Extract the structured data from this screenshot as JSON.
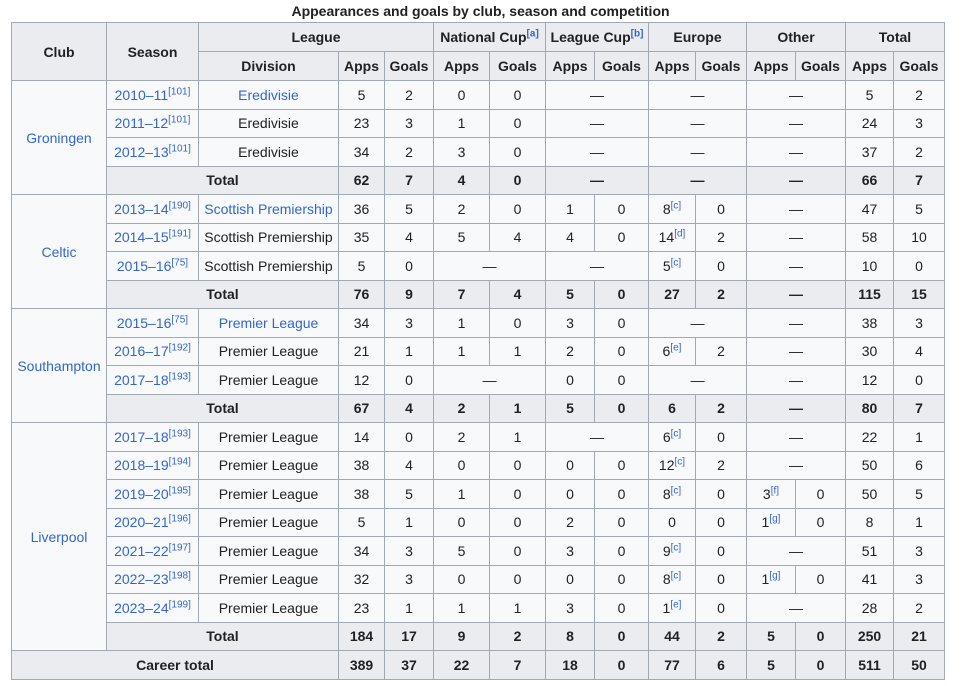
{
  "caption": "Appearances and goals by club, season and competition",
  "headers": {
    "club": "Club",
    "season": "Season",
    "league": "League",
    "national_cup": "National Cup",
    "national_cup_note": "[a]",
    "league_cup": "League Cup",
    "league_cup_note": "[b]",
    "europe": "Europe",
    "other": "Other",
    "total": "Total",
    "division": "Division",
    "apps": "Apps",
    "goals": "Goals"
  },
  "clubs": [
    {
      "name": "Groningen",
      "rows": [
        {
          "season": "2010–11",
          "ref": "[101]",
          "division": "Eredivisie",
          "division_link": true,
          "cells": [
            "5",
            "2",
            "0",
            "0",
            "—",
            "—",
            "—",
            "5",
            "2"
          ],
          "layout": "sng"
        },
        {
          "season": "2011–12",
          "ref": "[101]",
          "division": "Eredivisie",
          "division_link": false,
          "cells": [
            "23",
            "3",
            "1",
            "0",
            "—",
            "—",
            "—",
            "24",
            "3"
          ],
          "layout": "sng"
        },
        {
          "season": "2012–13",
          "ref": "[101]",
          "division": "Eredivisie",
          "division_link": false,
          "cells": [
            "34",
            "2",
            "3",
            "0",
            "—",
            "—",
            "—",
            "37",
            "2"
          ],
          "layout": "sng"
        }
      ],
      "total": {
        "label": "Total",
        "cells": [
          "62",
          "7",
          "4",
          "0",
          "—",
          "—",
          "—",
          "66",
          "7"
        ],
        "layout": "sng"
      }
    },
    {
      "name": "Celtic",
      "rows": [
        {
          "season": "2013–14",
          "ref": "[190]",
          "division": "Scottish Premiership",
          "division_link": true,
          "cells": [
            "36",
            "5",
            "2",
            "0",
            "1",
            "0",
            "8",
            "[c]",
            "0",
            "—",
            "47",
            "5"
          ],
          "layout": "full"
        },
        {
          "season": "2014–15",
          "ref": "[191]",
          "division": "Scottish Premiership",
          "division_link": false,
          "cells": [
            "35",
            "4",
            "5",
            "4",
            "4",
            "0",
            "14",
            "[d]",
            "2",
            "—",
            "58",
            "10"
          ],
          "layout": "full"
        },
        {
          "season": "2015–16",
          "ref": "[75]",
          "division": "Scottish Premiership",
          "division_link": false,
          "cells": [
            "5",
            "0",
            "—",
            "—",
            "5",
            "[c]",
            "0",
            "—",
            "10",
            "0"
          ],
          "layout": "nc_lc_span"
        }
      ],
      "total": {
        "label": "Total",
        "cells": [
          "76",
          "9",
          "7",
          "4",
          "5",
          "0",
          "27",
          "2",
          "—",
          "115",
          "15"
        ],
        "layout": "total_full"
      }
    },
    {
      "name": "Southampton",
      "rows": [
        {
          "season": "2015–16",
          "ref": "[75]",
          "division": "Premier League",
          "division_link": true,
          "cells": [
            "34",
            "3",
            "1",
            "0",
            "3",
            "0",
            "—",
            "—",
            "38",
            "3"
          ],
          "layout": "eu_span"
        },
        {
          "season": "2016–17",
          "ref": "[192]",
          "division": "Premier League",
          "division_link": false,
          "cells": [
            "21",
            "1",
            "1",
            "1",
            "2",
            "0",
            "6",
            "[e]",
            "2",
            "—",
            "30",
            "4"
          ],
          "layout": "full"
        },
        {
          "season": "2017–18",
          "ref": "[193]",
          "division": "Premier League",
          "division_link": false,
          "cells": [
            "12",
            "0",
            "—",
            "0",
            "0",
            "—",
            "—",
            "12",
            "0"
          ],
          "layout": "nc_span_eu_span"
        }
      ],
      "total": {
        "label": "Total",
        "cells": [
          "67",
          "4",
          "2",
          "1",
          "5",
          "0",
          "6",
          "2",
          "—",
          "80",
          "7"
        ],
        "layout": "total_full"
      }
    },
    {
      "name": "Liverpool",
      "rows": [
        {
          "season": "2017–18",
          "ref": "[193]",
          "division": "Premier League",
          "division_link": false,
          "cells": [
            "14",
            "0",
            "2",
            "1",
            "—",
            "6",
            "[c]",
            "0",
            "—",
            "22",
            "1"
          ],
          "layout": "lc_span"
        },
        {
          "season": "2018–19",
          "ref": "[194]",
          "division": "Premier League",
          "division_link": false,
          "cells": [
            "38",
            "4",
            "0",
            "0",
            "0",
            "0",
            "12",
            "[c]",
            "2",
            "—",
            "50",
            "6"
          ],
          "layout": "full"
        },
        {
          "season": "2019–20",
          "ref": "[195]",
          "division": "Premier League",
          "division_link": false,
          "cells": [
            "38",
            "5",
            "1",
            "0",
            "0",
            "0",
            "8",
            "[c]",
            "0",
            "3",
            "[f]",
            "0",
            "50",
            "5"
          ],
          "layout": "full_other"
        },
        {
          "season": "2020–21",
          "ref": "[196]",
          "division": "Premier League",
          "division_link": false,
          "cells": [
            "5",
            "1",
            "0",
            "0",
            "2",
            "0",
            "0",
            "",
            "0",
            "1",
            "[g]",
            "0",
            "8",
            "1"
          ],
          "layout": "full_other"
        },
        {
          "season": "2021–22",
          "ref": "[197]",
          "division": "Premier League",
          "division_link": false,
          "cells": [
            "34",
            "3",
            "5",
            "0",
            "3",
            "0",
            "9",
            "[c]",
            "0",
            "—",
            "51",
            "3"
          ],
          "layout": "full"
        },
        {
          "season": "2022–23",
          "ref": "[198]",
          "division": "Premier League",
          "division_link": false,
          "cells": [
            "32",
            "3",
            "0",
            "0",
            "0",
            "0",
            "8",
            "[c]",
            "0",
            "1",
            "[g]",
            "0",
            "41",
            "3"
          ],
          "layout": "full_other"
        },
        {
          "season": "2023–24",
          "ref": "[199]",
          "division": "Premier League",
          "division_link": false,
          "cells": [
            "23",
            "1",
            "1",
            "1",
            "3",
            "0",
            "1",
            "[e]",
            "0",
            "—",
            "28",
            "2"
          ],
          "layout": "full"
        }
      ],
      "total": {
        "label": "Total",
        "cells": [
          "184",
          "17",
          "9",
          "2",
          "8",
          "0",
          "44",
          "2",
          "5",
          "0",
          "250",
          "21"
        ],
        "layout": "total_other"
      }
    }
  ],
  "career_total": {
    "label": "Career total",
    "cells": [
      "389",
      "37",
      "22",
      "7",
      "18",
      "0",
      "77",
      "6",
      "5",
      "0",
      "511",
      "50"
    ]
  }
}
